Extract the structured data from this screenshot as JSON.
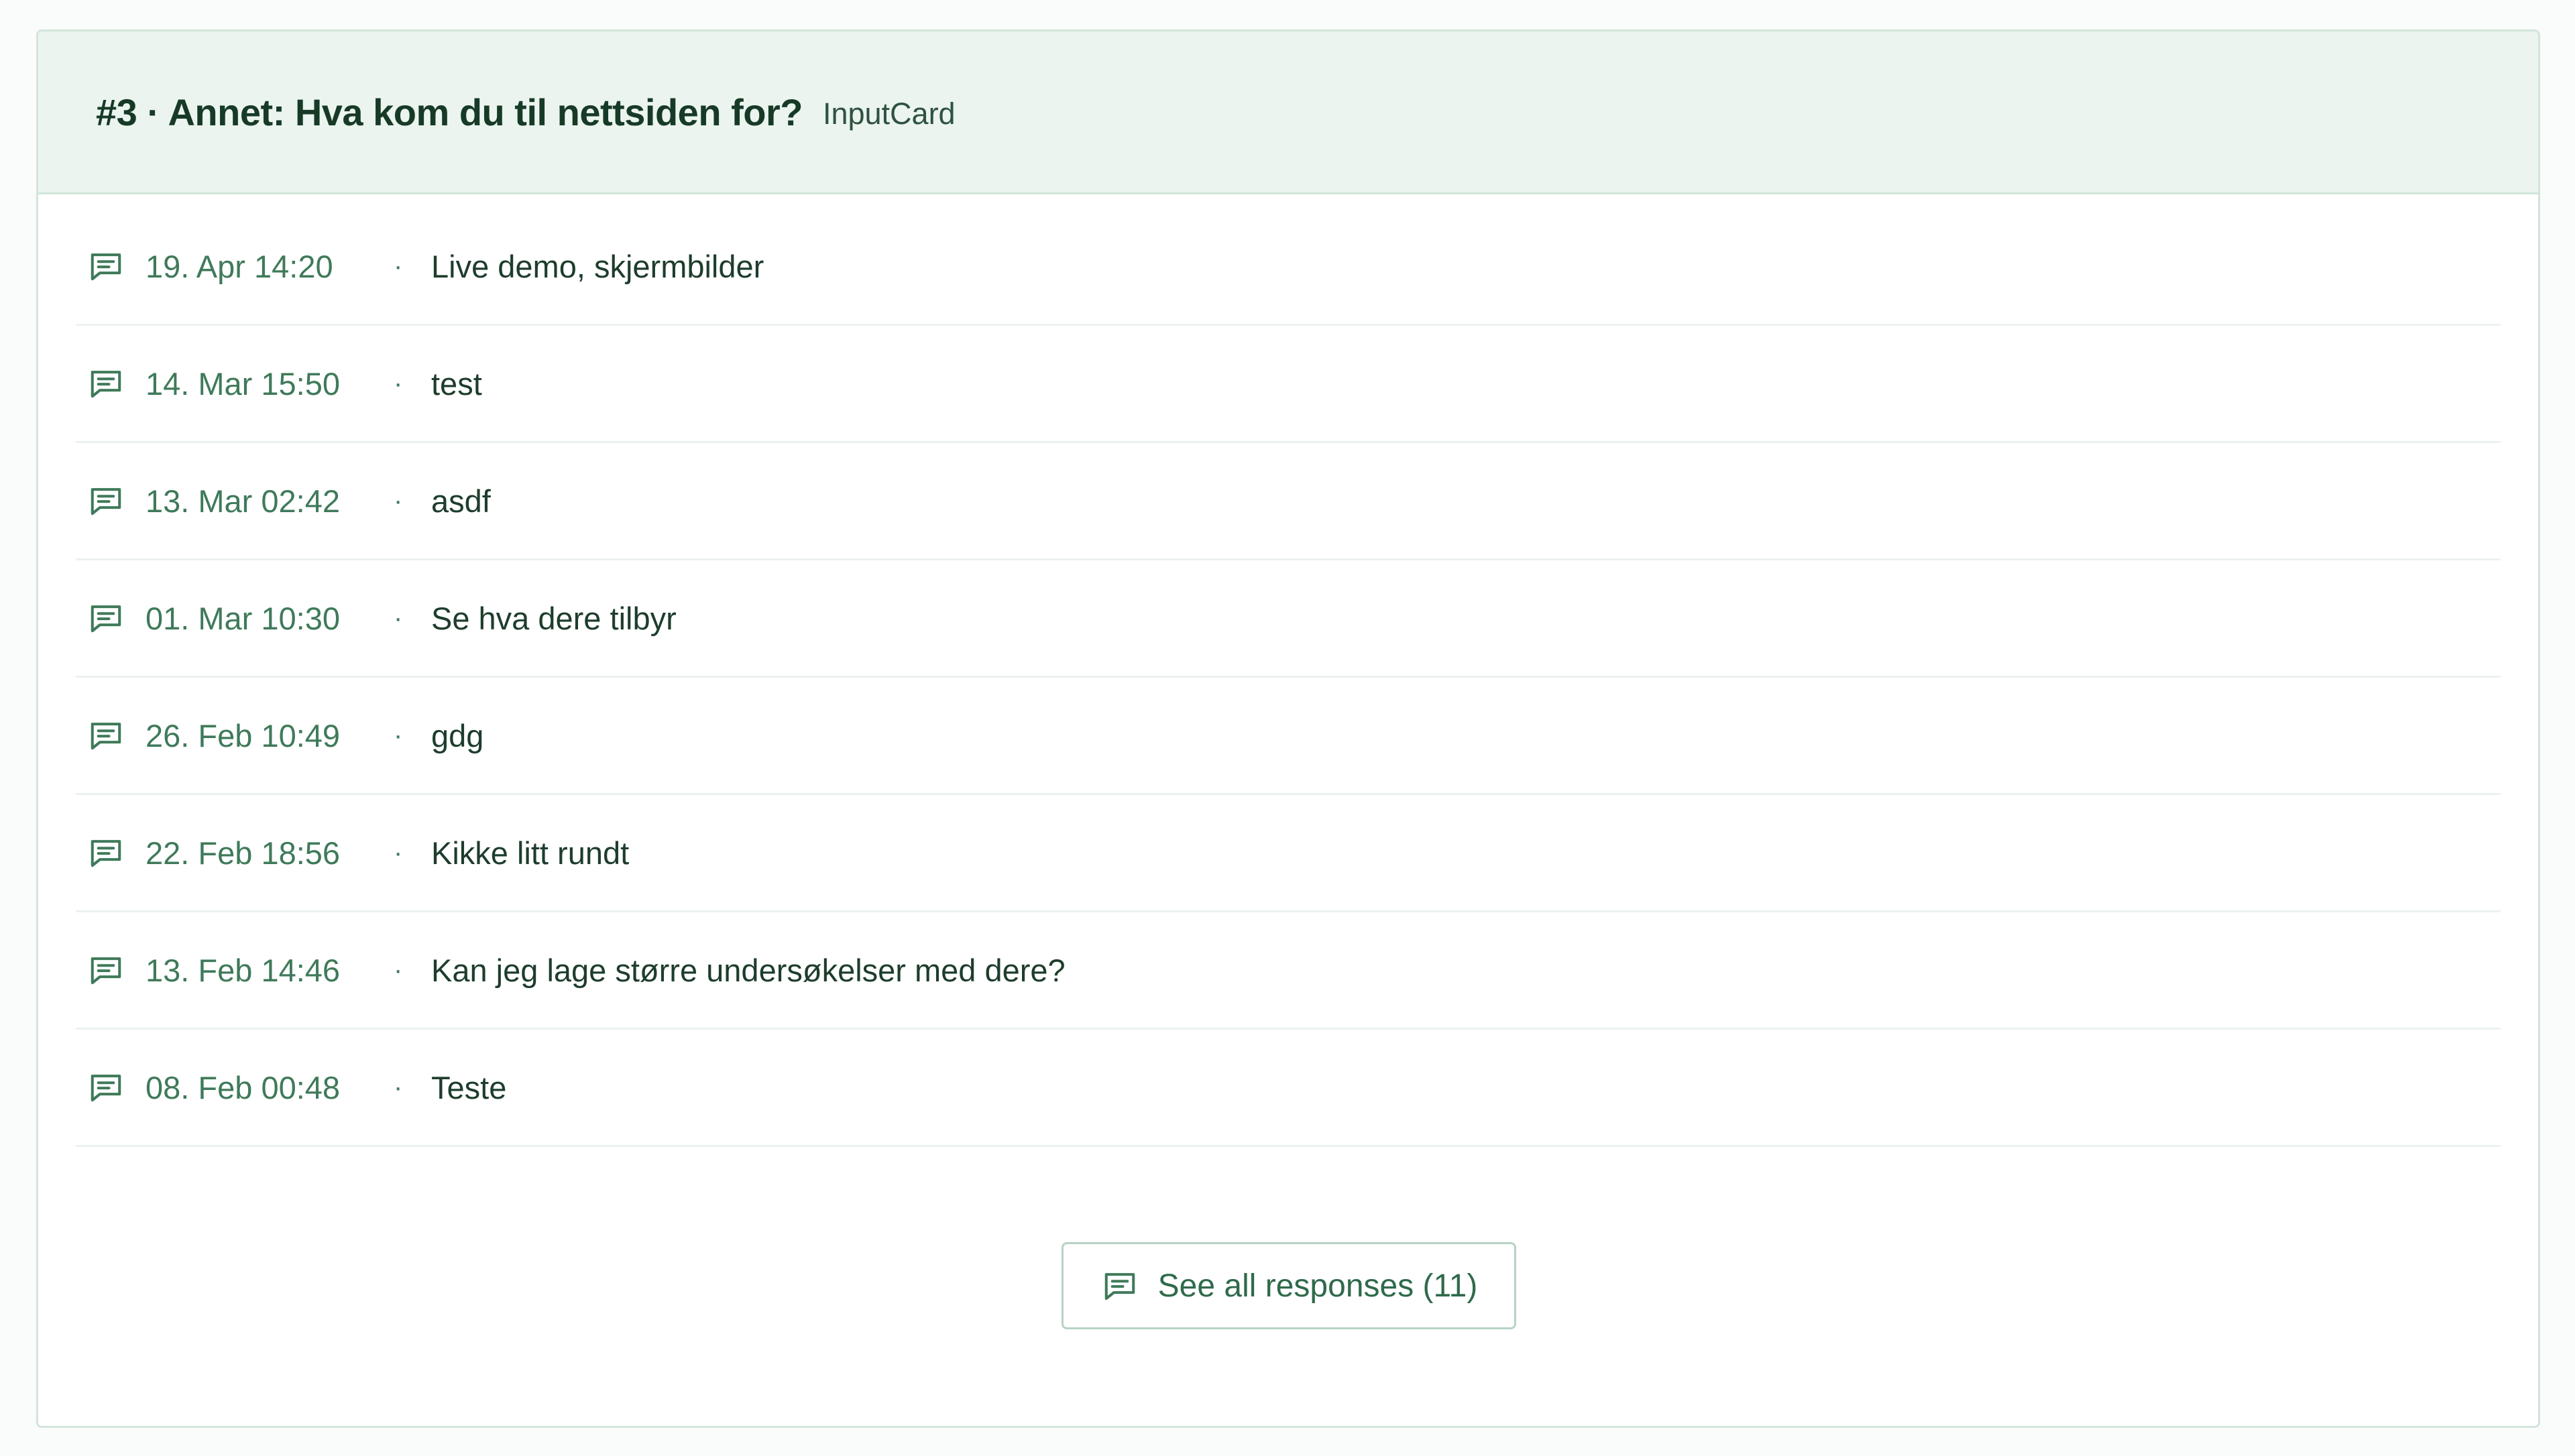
{
  "header": {
    "title": "#3 · Annet: Hva kom du til nettsiden for?",
    "type_label": "InputCard"
  },
  "responses": [
    {
      "date": "19. Apr 14:20",
      "separator": "·",
      "text": "Live demo, skjermbilder",
      "icon": "message-icon"
    },
    {
      "date": "14. Mar 15:50",
      "separator": "·",
      "text": "test",
      "icon": "message-icon"
    },
    {
      "date": "13. Mar 02:42",
      "separator": "·",
      "text": "asdf",
      "icon": "message-icon"
    },
    {
      "date": "01. Mar 10:30",
      "separator": "·",
      "text": "Se hva dere tilbyr",
      "icon": "message-icon"
    },
    {
      "date": "26. Feb 10:49",
      "separator": "·",
      "text": "gdg",
      "icon": "message-icon"
    },
    {
      "date": "22. Feb 18:56",
      "separator": "·",
      "text": "Kikke litt rundt",
      "icon": "message-icon"
    },
    {
      "date": "13. Feb 14:46",
      "separator": "·",
      "text": "Kan jeg lage større undersøkelser med dere?",
      "icon": "message-icon"
    },
    {
      "date": "08. Feb 00:48",
      "separator": "·",
      "text": "Teste",
      "icon": "message-icon"
    }
  ],
  "see_all_button": {
    "label": "See all responses (11)",
    "icon": "message-icon"
  },
  "colors": {
    "header_bg": "#ebf4ef",
    "accent": "#3f7a5a",
    "text": "#1e3d2c",
    "border": "#d3e5da"
  }
}
